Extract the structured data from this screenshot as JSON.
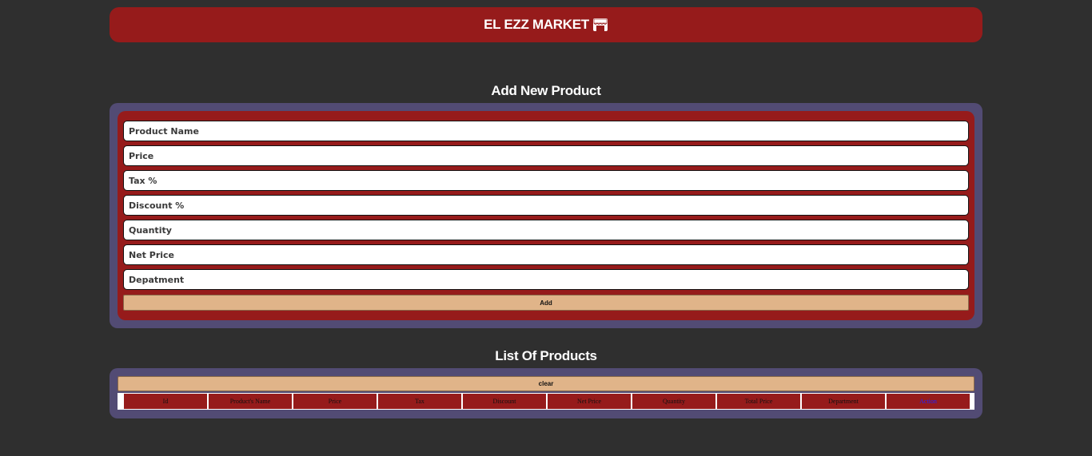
{
  "header": {
    "title": "EL EZZ MARKET",
    "icon": "store-icon"
  },
  "form": {
    "title": "Add New Product",
    "fields": {
      "product_name": {
        "placeholder": "Product Name",
        "value": ""
      },
      "price": {
        "placeholder": "Price",
        "value": ""
      },
      "tax": {
        "placeholder": "Tax %",
        "value": ""
      },
      "discount": {
        "placeholder": "Discount %",
        "value": ""
      },
      "quantity": {
        "placeholder": "Quantity",
        "value": ""
      },
      "net_price": {
        "placeholder": "Net Price",
        "value": ""
      },
      "department": {
        "placeholder": "Depatment",
        "value": ""
      }
    },
    "add_label": "Add"
  },
  "list": {
    "title": "List Of Products",
    "clear_label": "clear",
    "columns": [
      "Id",
      "Product's Name",
      "Price",
      "Tax",
      "Discount",
      "Net Price",
      "Quantity",
      "Total Price",
      "Department",
      "Action"
    ]
  },
  "colors": {
    "background": "#2f2f2f",
    "header_red": "#961b1b",
    "panel_purple": "#524b74",
    "button_tan": "#e0b489",
    "action_link": "#2020ff"
  }
}
